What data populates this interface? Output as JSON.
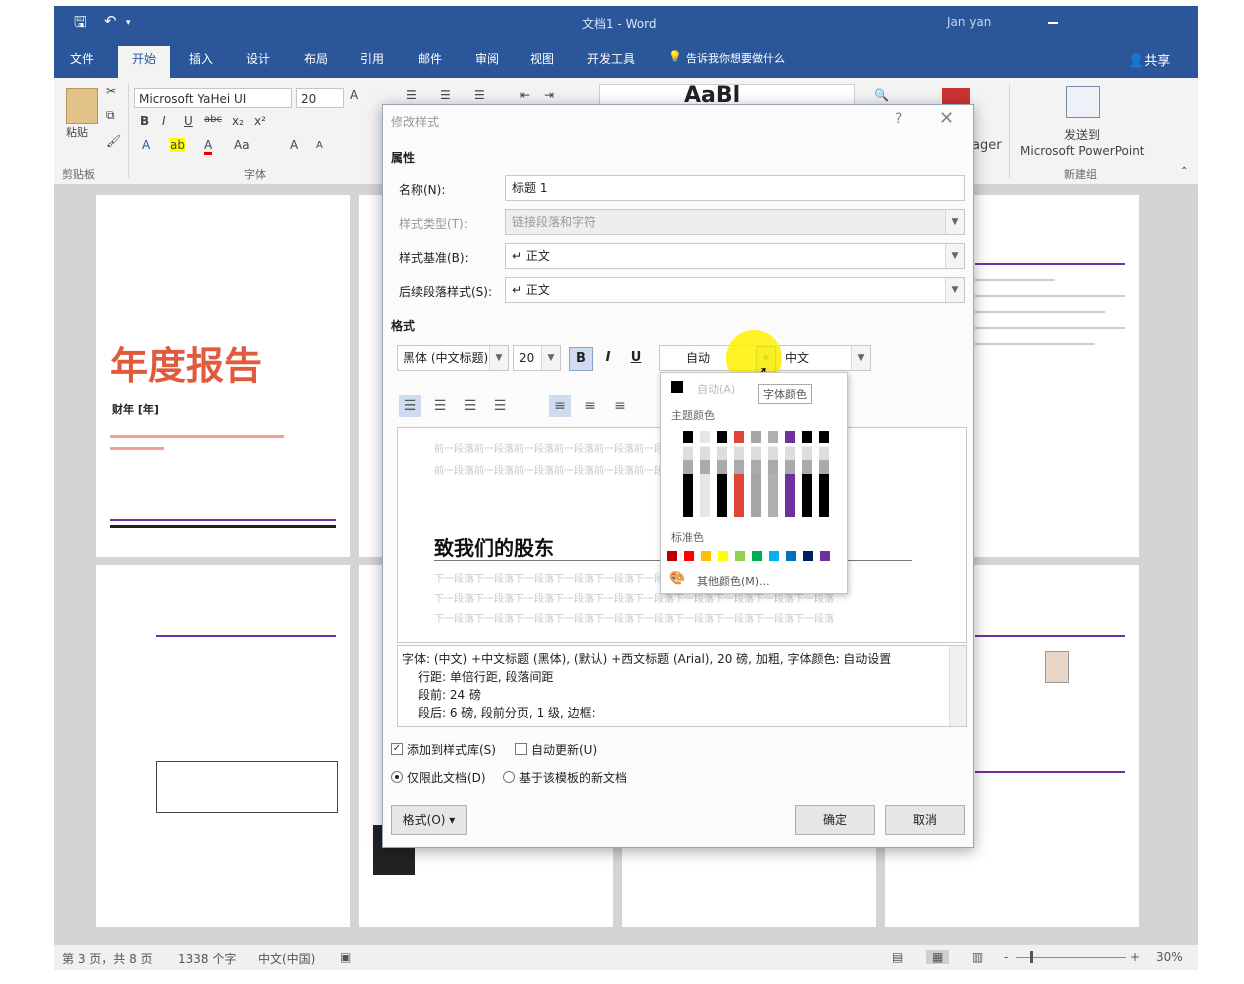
{
  "window": {
    "title": "文档1 - Word",
    "user": "Jan yan"
  },
  "tabs": [
    {
      "label": "文件"
    },
    {
      "label": "开始"
    },
    {
      "label": "插入"
    },
    {
      "label": "设计"
    },
    {
      "label": "布局"
    },
    {
      "label": "引用"
    },
    {
      "label": "邮件"
    },
    {
      "label": "审阅"
    },
    {
      "label": "视图"
    },
    {
      "label": "开发工具"
    },
    {
      "label": "告诉我你想要做什么"
    }
  ],
  "share_label": "共享",
  "ribbon": {
    "paste_label": "粘贴",
    "clipboard_group": "剪贴板",
    "font_group": "字体",
    "font_name": "Microsoft YaHei UI",
    "font_size": "20",
    "style_preview": "AaBl",
    "manager_partial": "ager",
    "send_to_line1": "发送到",
    "send_to_line2": "Microsoft PowerPoint",
    "new_group": "新建组"
  },
  "document": {
    "cover_title": "年度报告",
    "cover_year": "财年 [年]",
    "heading_preview": "致我们的股东"
  },
  "dialog": {
    "title": "修改样式",
    "help": "?",
    "close": "✕",
    "properties_section": "属性",
    "name_label": "名称(N):",
    "name_value": "标题 1",
    "style_type_label": "样式类型(T):",
    "style_type_value": "链接段落和字符",
    "based_on_label": "样式基准(B):",
    "based_on_value": "正文",
    "next_style_label": "后续段落样式(S):",
    "next_style_value": "正文",
    "format_section": "格式",
    "font_value": "黑体 (中文标题)",
    "size_value": "20",
    "bold": "B",
    "italic": "I",
    "underline": "U",
    "color_value": "自动",
    "script_value": "中文",
    "preview_prev_text": "前一段落前一段落前一段落前一段落前一段落前一段落前一段落前一段落前一段落前一段落",
    "preview_heading": "致我们的股东",
    "preview_next_text": "下一段落下一段落下一段落下一段落下一段落下一段落下一段落下一段落下一段落下一段落",
    "description_lines": [
      "字体: (中文) +中文标题 (黑体), (默认) +西文标题 (Arial), 20 磅, 加粗, 字体颜色: 自动设置",
      "行距: 单倍行距, 段落间距",
      "段前: 24 磅",
      "段后: 6 磅, 段前分页, 1 级, 边框:"
    ],
    "add_to_gallery_label": "添加到样式库(S)",
    "add_to_gallery_checked": true,
    "auto_update_label": "自动更新(U)",
    "auto_update_checked": false,
    "only_this_doc_label": "仅限此文档(D)",
    "new_docs_label": "基于该模板的新文档",
    "format_button": "格式(O) ▾",
    "ok_button": "确定",
    "cancel_button": "取消"
  },
  "color_popup": {
    "auto_label": "自动(A)",
    "tooltip": "字体颜色",
    "theme_colors_label": "主题颜色",
    "standard_colors_label": "标准色",
    "more_colors_label": "其他颜色(M)...",
    "standard_colors": [
      "#c00000",
      "#ff0000",
      "#ffc000",
      "#ffff00",
      "#92d050",
      "#00b050",
      "#00b0f0",
      "#0070c0",
      "#002060",
      "#7030a0"
    ]
  },
  "statusbar": {
    "page": "第 3 页，共 8 页",
    "words": "1338 个字",
    "language": "中文(中国)",
    "zoom": "30%"
  }
}
